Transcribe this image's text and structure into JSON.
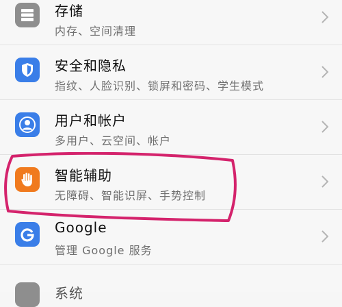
{
  "settings": {
    "items": [
      {
        "title": "存储",
        "subtitle": "内存、空间清理",
        "icon": "storage-icon",
        "icon_color": "#8e8e8e"
      },
      {
        "title": "安全和隐私",
        "subtitle": "指纹、人脸识别、锁屏和密码、学生模式",
        "icon": "shield-icon",
        "icon_color": "#3a7ee8"
      },
      {
        "title": "用户和帐户",
        "subtitle": "多用户、云空间、帐户",
        "icon": "user-icon",
        "icon_color": "#3a7ee8"
      },
      {
        "title": "智能辅助",
        "subtitle": "无障碍、智能识屏、手势控制",
        "icon": "hand-icon",
        "icon_color": "#f07a1e"
      },
      {
        "title": "Google",
        "subtitle": "管理 Google 服务",
        "icon": "google-icon",
        "icon_color": "#3a7ee8"
      },
      {
        "title": "系统",
        "icon": "system-icon",
        "icon_color": "#8e8e8e"
      }
    ]
  },
  "annotation": {
    "color": "#d4236c"
  }
}
